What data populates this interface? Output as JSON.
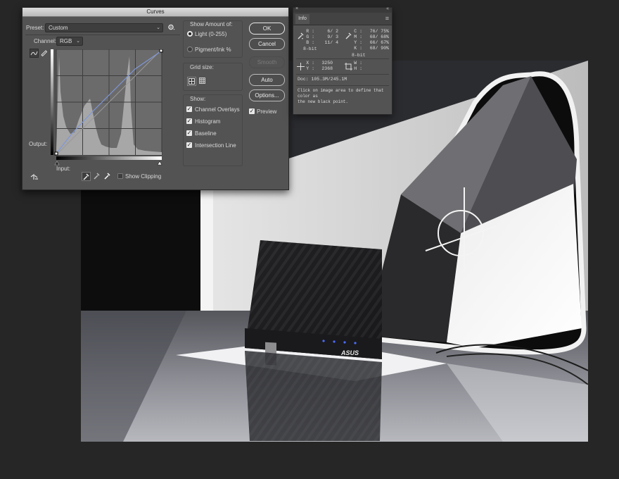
{
  "curves_dialog": {
    "title": "Curves",
    "preset_label": "Preset:",
    "preset_value": "Custom",
    "channel_label": "Channel:",
    "channel_value": "RGB",
    "output_label": "Output:",
    "input_label": "Input:",
    "show_clipping_label": "Show Clipping",
    "show_clipping_checked": false,
    "show_amount": {
      "title": "Show Amount of:",
      "light_label": "Light  (0-255)",
      "pigment_label": "Pigment/Ink %",
      "selected": "light"
    },
    "grid_size_label": "Grid size:",
    "show": {
      "title": "Show:",
      "items": [
        {
          "label": "Channel Overlays",
          "checked": true
        },
        {
          "label": "Histogram",
          "checked": true
        },
        {
          "label": "Baseline",
          "checked": true
        },
        {
          "label": "Intersection Line",
          "checked": true
        }
      ]
    },
    "buttons": {
      "ok": "OK",
      "cancel": "Cancel",
      "smooth": "Smooth",
      "auto": "Auto",
      "options": "Options..."
    },
    "preview_label": "Preview",
    "preview_checked": true
  },
  "info_panel": {
    "tab": "Info",
    "rgb_left": {
      "labels": [
        "R :",
        "G :",
        "B :"
      ],
      "values": [
        "6/   2",
        "9/   3",
        "11/   4"
      ],
      "bits": "8-bit"
    },
    "cmyk_right": {
      "labels": [
        "C :",
        "M :",
        "Y :",
        "K :"
      ],
      "values": [
        "76/  75%",
        "68/  68%",
        "66/  67%",
        "68/  90%"
      ],
      "bits": "8-bit"
    },
    "xy": {
      "labels": [
        "X :",
        "Y :"
      ],
      "values": [
        "3250",
        "2368"
      ]
    },
    "wh": {
      "labels": [
        "W :",
        "H :"
      ]
    },
    "doc": "Doc: 105.3M/245.1M",
    "hint_line1": "Click on image area to define that color as",
    "hint_line2": "the new black point."
  },
  "photo": {
    "brand": "ASUS"
  },
  "colors": {
    "app_background": "#262626",
    "panel_background": "#535353",
    "curve_line": "#7f97d8"
  }
}
